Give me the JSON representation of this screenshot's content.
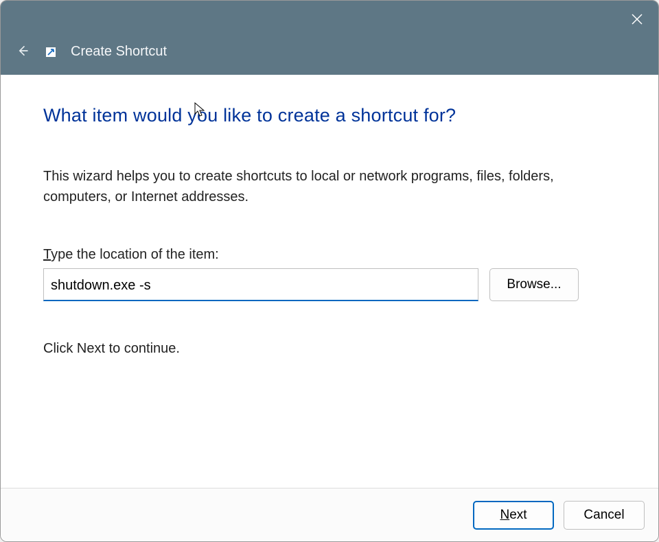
{
  "window": {
    "title": "Create Shortcut"
  },
  "heading": "What item would you like to create a shortcut for?",
  "description": "This wizard helps you to create shortcuts to local or network programs, files, folders, computers, or Internet addresses.",
  "location": {
    "label_prefix": "T",
    "label_rest": "ype the location of the item:",
    "value": "shutdown.exe -s"
  },
  "browse_label": "Browse...",
  "continue_text": "Click Next to continue.",
  "footer": {
    "next_prefix": "N",
    "next_rest": "ext",
    "cancel": "Cancel"
  }
}
